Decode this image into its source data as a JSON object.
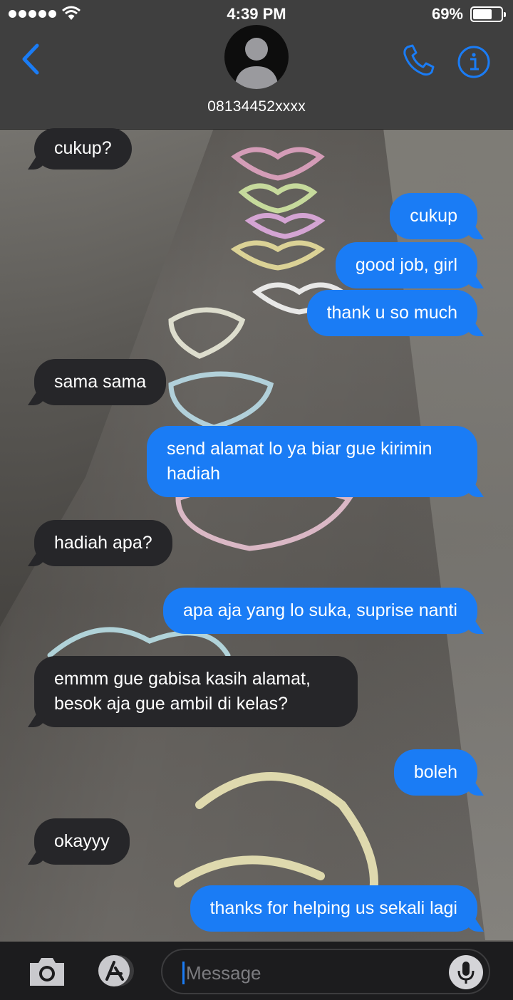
{
  "status_bar": {
    "time": "4:39 PM",
    "battery": "69%",
    "battery_level": 0.69
  },
  "header": {
    "contact": "08134452xxxx",
    "icons": [
      "back-chevron-icon",
      "avatar-placeholder-icon",
      "phone-icon",
      "info-icon"
    ]
  },
  "messages": [
    {
      "from": "them",
      "text": "cukup?"
    },
    {
      "from": "me",
      "text": "cukup"
    },
    {
      "from": "me",
      "text": "good job, girl"
    },
    {
      "from": "me",
      "text": "thank u so much"
    },
    {
      "from": "them",
      "text": "sama sama"
    },
    {
      "from": "me",
      "text": "send alamat lo ya biar gue kirimin hadiah"
    },
    {
      "from": "them",
      "text": "hadiah apa?"
    },
    {
      "from": "me",
      "text": "apa aja yang lo suka, suprise nanti"
    },
    {
      "from": "them",
      "text": "emmm gue gabisa kasih alamat, besok aja gue ambil di kelas?"
    },
    {
      "from": "me",
      "text": "boleh"
    },
    {
      "from": "them",
      "text": "okayyy"
    },
    {
      "from": "me",
      "text": "thanks for helping us sekali lagi"
    }
  ],
  "input": {
    "placeholder": "Message",
    "icons": [
      "camera-icon",
      "app-store-icon",
      "microphone-icon"
    ]
  },
  "colors": {
    "outgoing_bubble": "#1a7cf5",
    "incoming_bubble": "#262629",
    "accent": "#1a7cf5",
    "header_bg": "#3f3f3f"
  }
}
